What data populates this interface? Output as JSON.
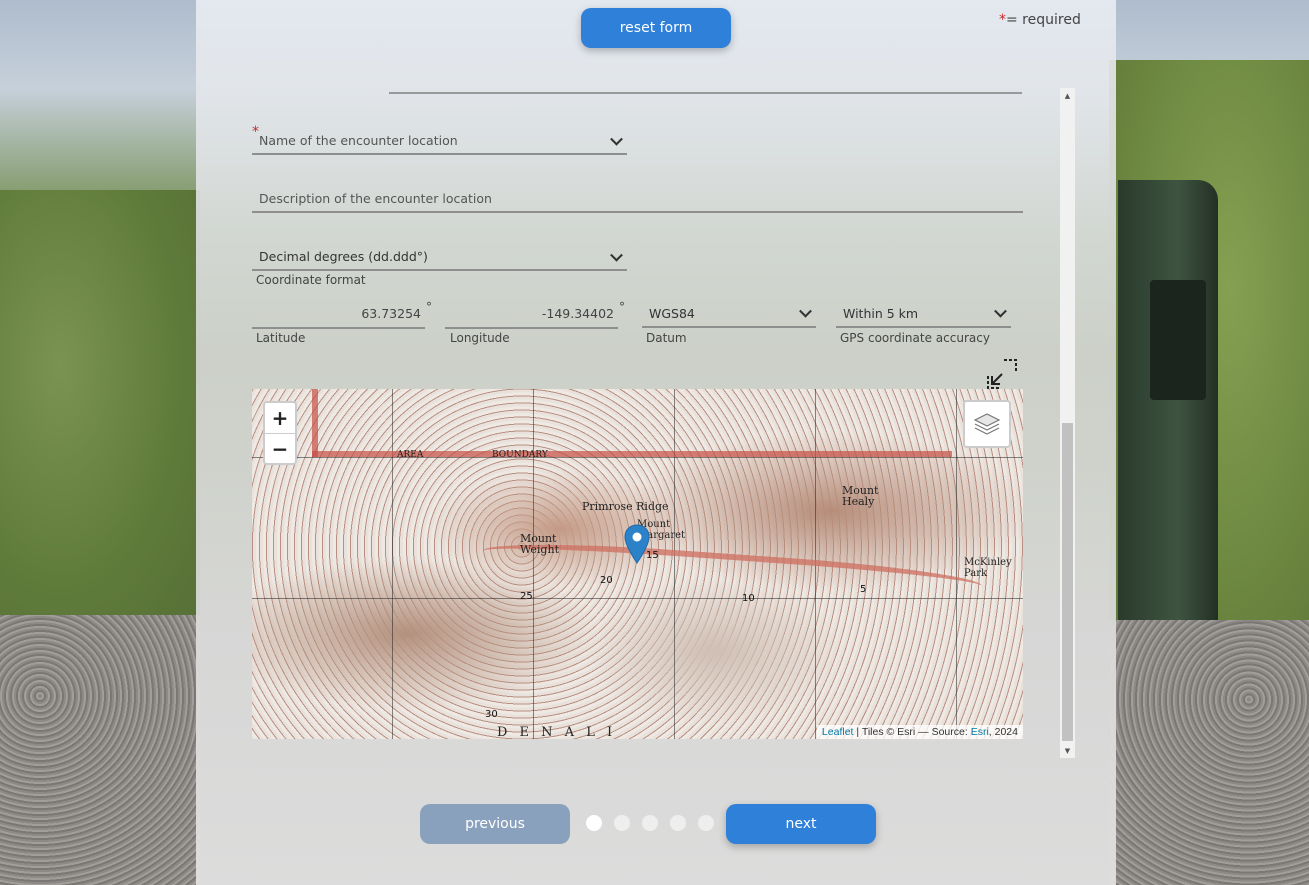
{
  "header": {
    "reset_label": "reset form",
    "required_star": "*",
    "required_text": "= required"
  },
  "form": {
    "location_name": {
      "label": "Name of the encounter location",
      "required_star": "*"
    },
    "location_description": {
      "placeholder": "Description of the encounter location"
    },
    "coordinate_format": {
      "value": "Decimal degrees (dd.ddd°)",
      "helper": "Coordinate format"
    },
    "latitude": {
      "value": "63.73254",
      "unit": "°",
      "helper": "Latitude"
    },
    "longitude": {
      "value": "-149.34402",
      "unit": "°",
      "helper": "Longitude"
    },
    "datum": {
      "value": "WGS84",
      "helper": "Datum"
    },
    "gps_accuracy": {
      "value": "Within 5 km",
      "helper": "GPS coordinate accuracy"
    }
  },
  "map": {
    "zoom_in": "+",
    "zoom_out": "−",
    "labels": {
      "boundary": "BOUNDARY",
      "area": "AREA",
      "primrose": "Primrose Ridge",
      "mount_weight": "Mount Weight",
      "mount_healy": "Mount Healy",
      "mckinley_park": "McKinley Park",
      "denali": "D E N A L I",
      "mount_margaret": "Mount Margaret"
    },
    "numbers": [
      "15",
      "20",
      "25",
      "10",
      "5",
      "30"
    ],
    "attribution": {
      "leaflet": "Leaflet",
      "sep": " | Tiles © Esri — Source: ",
      "esri": "Esri",
      "year": ", 2024"
    }
  },
  "footer": {
    "previous_label": "previous",
    "next_label": "next",
    "steps": 5,
    "active_step": 1
  },
  "colors": {
    "primary": "#2f80d9",
    "disabled": "#8aa1bd",
    "required": "#c62828"
  }
}
